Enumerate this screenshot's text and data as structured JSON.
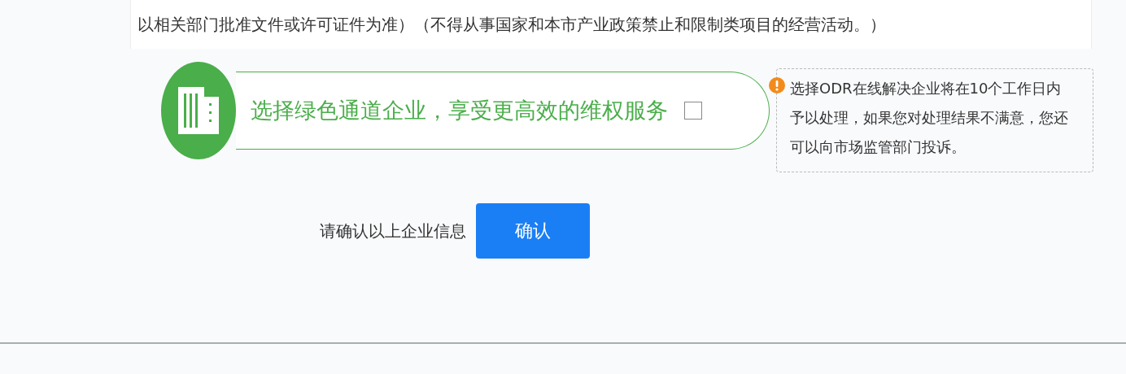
{
  "scope_note": "以相关部门批准文件或许可证件为准）（不得从事国家和本市产业政策禁止和限制类项目的经营活动。）",
  "green_channel": {
    "label": "选择绿色通道企业，享受更高效的维权服务",
    "checked": false
  },
  "tip": "选择ODR在线解决企业将在10个工作日内予以处理，如果您对处理结果不满意，您还可以向市场监管部门投诉。",
  "confirm": {
    "prompt": "请确认以上企业信息",
    "button": "确认"
  }
}
